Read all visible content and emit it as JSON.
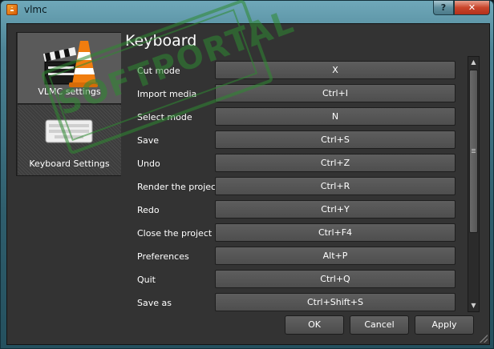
{
  "window": {
    "title": "vlmc",
    "help_label": "?",
    "close_label": "✕"
  },
  "sidebar": {
    "items": [
      {
        "label": "VLMC settings",
        "icon": "clapperboard-cone-icon",
        "selected": true
      },
      {
        "label": "Keyboard Settings",
        "icon": "keyboard-icon",
        "selected": false
      }
    ]
  },
  "main": {
    "title": "Keyboard",
    "shortcuts": [
      {
        "action": "Cut mode",
        "key": "X"
      },
      {
        "action": "Import media",
        "key": "Ctrl+I"
      },
      {
        "action": "Select mode",
        "key": "N"
      },
      {
        "action": "Save",
        "key": "Ctrl+S"
      },
      {
        "action": "Undo",
        "key": "Ctrl+Z"
      },
      {
        "action": "Render the project",
        "key": "Ctrl+R"
      },
      {
        "action": "Redo",
        "key": "Ctrl+Y"
      },
      {
        "action": "Close the project",
        "key": "Ctrl+F4"
      },
      {
        "action": "Preferences",
        "key": "Alt+P"
      },
      {
        "action": "Quit",
        "key": "Ctrl+Q"
      },
      {
        "action": "Save as",
        "key": "Ctrl+Shift+S"
      }
    ]
  },
  "buttons": {
    "ok": "OK",
    "cancel": "Cancel",
    "apply": "Apply"
  },
  "watermark": {
    "text": "SOFTPORTAL"
  },
  "colors": {
    "panel_bg": "#333333",
    "button_bg": "#565656",
    "selected_bg": "#5a5a5a",
    "stamp": "#2f8a32"
  }
}
